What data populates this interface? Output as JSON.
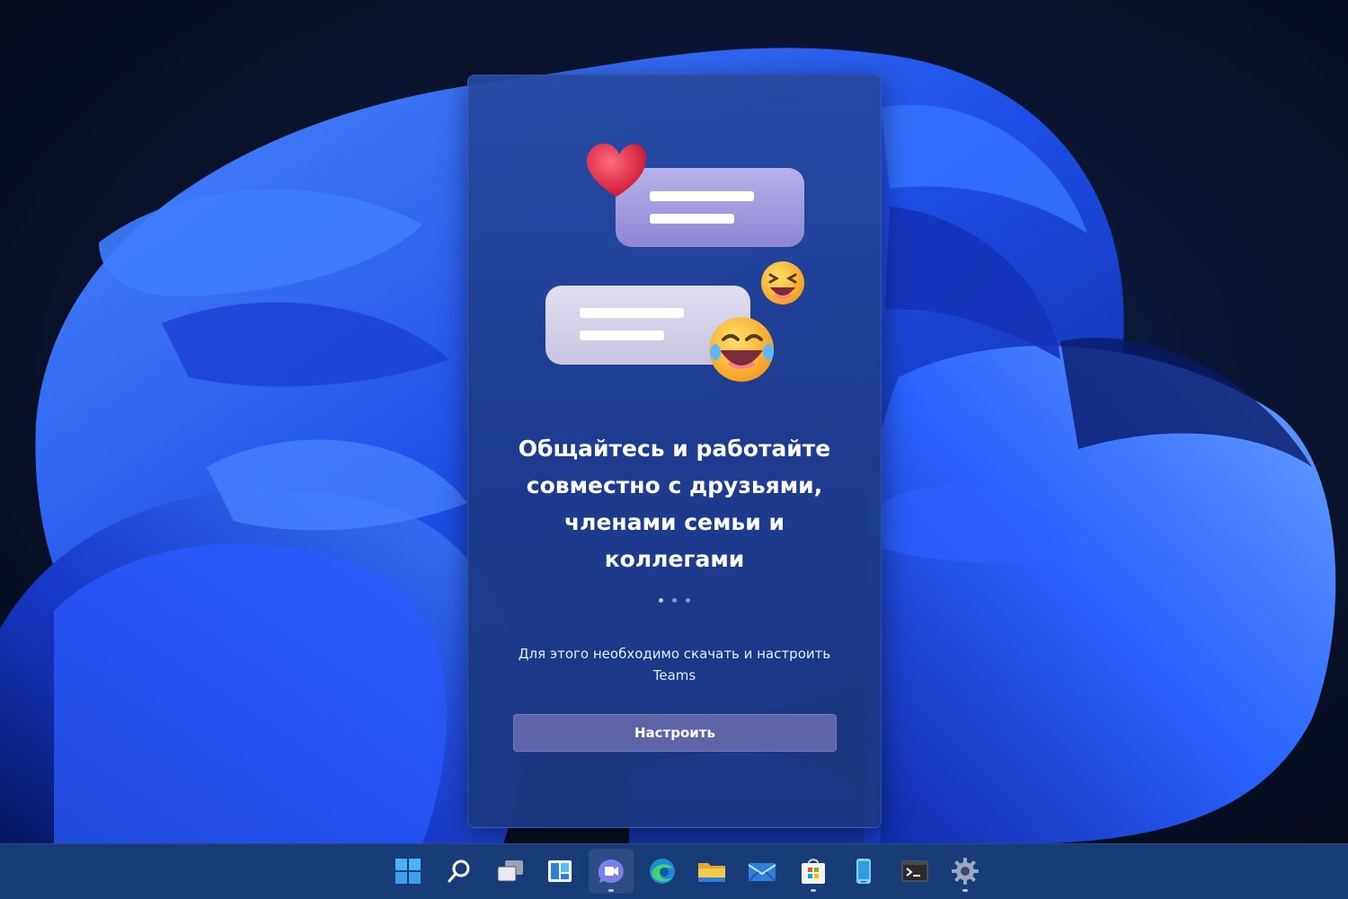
{
  "popup": {
    "headline_lines": [
      "Общайтесь и работайте",
      "совместно с друзьями,",
      "членами семьи и",
      "коллегами"
    ],
    "pager": {
      "total": 3,
      "current": 1
    },
    "subtext_lines": [
      "Для этого необходимо скачать и настроить",
      "Teams"
    ],
    "setup_button_label": "Настроить"
  },
  "taskbar": {
    "icons": [
      {
        "name": "start-icon",
        "active": false
      },
      {
        "name": "search-icon",
        "active": false
      },
      {
        "name": "task-view-icon",
        "active": false
      },
      {
        "name": "widgets-icon",
        "active": false
      },
      {
        "name": "chat-icon",
        "active": true
      },
      {
        "name": "edge-icon",
        "active": false
      },
      {
        "name": "file-explorer-icon",
        "active": false
      },
      {
        "name": "mail-icon",
        "active": false
      },
      {
        "name": "store-icon",
        "active": false,
        "running": true
      },
      {
        "name": "phone-icon",
        "active": false
      },
      {
        "name": "terminal-icon",
        "active": false
      },
      {
        "name": "settings-icon",
        "active": false,
        "running": true
      }
    ]
  },
  "colors": {
    "popup_bg": "#264aa0",
    "button_bg": "#5f63a8",
    "taskbar_bg": "#183c78",
    "wallpaper_blue": "#1e46e0"
  }
}
